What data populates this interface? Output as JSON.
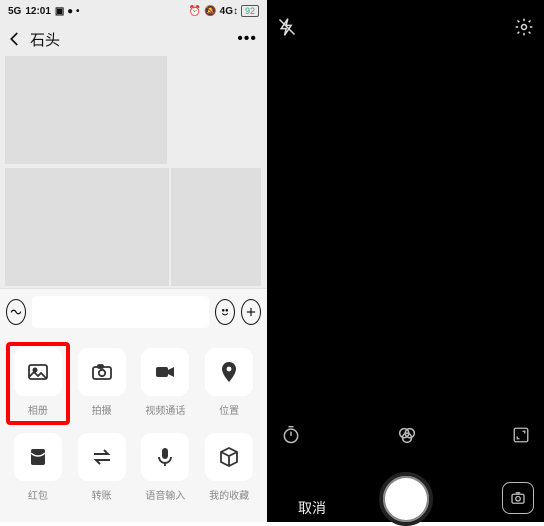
{
  "status": {
    "time": "12:01",
    "signal": "5G",
    "battery": "92"
  },
  "chat": {
    "title": "石头"
  },
  "input": {
    "placeholder": ""
  },
  "grid": [
    {
      "label": "相册"
    },
    {
      "label": "拍摄"
    },
    {
      "label": "视频通话"
    },
    {
      "label": "位置"
    },
    {
      "label": "红包"
    },
    {
      "label": "转账"
    },
    {
      "label": "语音输入"
    },
    {
      "label": "我的收藏"
    }
  ],
  "camera": {
    "cancel": "取消"
  }
}
